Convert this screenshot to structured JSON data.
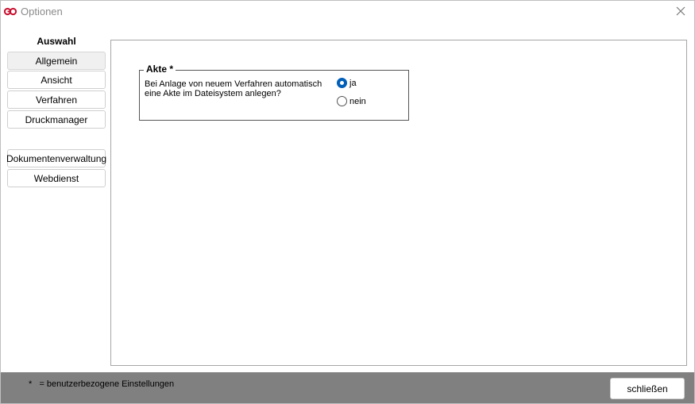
{
  "window": {
    "title": "Optionen"
  },
  "sidebar": {
    "heading": "Auswahl",
    "items": [
      {
        "label": "Allgemein",
        "active": true
      },
      {
        "label": "Ansicht"
      },
      {
        "label": "Verfahren"
      },
      {
        "label": "Druckmanager"
      },
      {
        "label": "Dokumentenverwaltung"
      },
      {
        "label": "Webdienst"
      }
    ]
  },
  "akte": {
    "legend": "Akte *",
    "question": "Bei Anlage von neuem Verfahren automatisch eine Akte im Dateisystem anlegen?",
    "options": [
      {
        "label": "ja",
        "selected": true
      },
      {
        "label": "nein",
        "selected": false
      }
    ]
  },
  "footer": {
    "note": "*   = benutzerbezogene Einstellungen",
    "close_label": "schließen"
  },
  "colors": {
    "accent": "#005fb8",
    "footer_bg": "#808080",
    "logo": "#c8102e"
  }
}
